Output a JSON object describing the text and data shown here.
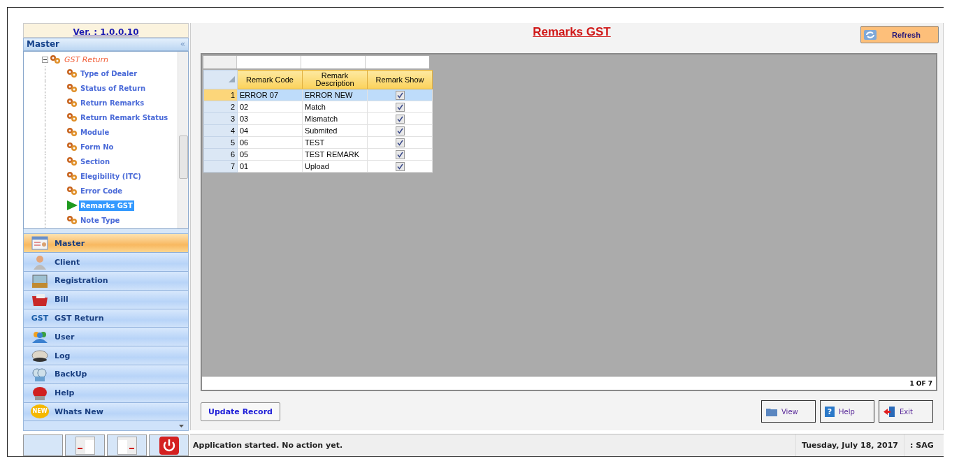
{
  "sidebar": {
    "version": "Ver. : 1.0.0.10",
    "panel_title": "Master",
    "collapse_glyph": "«",
    "tree": {
      "label": "GST Return",
      "expanded": true,
      "children": [
        {
          "label": "Type of Dealer",
          "selected": false
        },
        {
          "label": "Status of Return",
          "selected": false
        },
        {
          "label": "Return Remarks",
          "selected": false
        },
        {
          "label": "Return Remark Status",
          "selected": false
        },
        {
          "label": "Module",
          "selected": false
        },
        {
          "label": "Form No",
          "selected": false
        },
        {
          "label": "Section",
          "selected": false
        },
        {
          "label": "Elegibility (ITC)",
          "selected": false
        },
        {
          "label": "Error Code",
          "selected": false
        },
        {
          "label": "Remarks GST",
          "selected": true
        },
        {
          "label": "Note Type",
          "selected": false
        }
      ]
    }
  },
  "nav": [
    {
      "label": "Master",
      "selected": true
    },
    {
      "label": "Client",
      "selected": false
    },
    {
      "label": "Registration",
      "selected": false
    },
    {
      "label": "Bill",
      "selected": false
    },
    {
      "label": "GST Return",
      "selected": false,
      "icon_text": "GST"
    },
    {
      "label": "User",
      "selected": false
    },
    {
      "label": "Log",
      "selected": false
    },
    {
      "label": "BackUp",
      "selected": false
    },
    {
      "label": "Help",
      "selected": false
    },
    {
      "label": "Whats New",
      "selected": false,
      "icon_text": "NEW"
    }
  ],
  "page_title": "Remarks GST",
  "refresh_button": "Refresh",
  "grid": {
    "columns": [
      "Remark Code",
      "Remark Description",
      "Remark Show"
    ],
    "rows": [
      {
        "number": "1",
        "code": "ERROR 07",
        "description": "ERROR NEW",
        "show": true,
        "selected": true
      },
      {
        "number": "2",
        "code": "02",
        "description": "Match",
        "show": true,
        "selected": false
      },
      {
        "number": "3",
        "code": "03",
        "description": "Mismatch",
        "show": true,
        "selected": false
      },
      {
        "number": "4",
        "code": "04",
        "description": "Submited",
        "show": true,
        "selected": false
      },
      {
        "number": "5",
        "code": "06",
        "description": "TEST",
        "show": true,
        "selected": false
      },
      {
        "number": "6",
        "code": "05",
        "description": "TEST REMARK",
        "show": true,
        "selected": false
      },
      {
        "number": "7",
        "code": "01",
        "description": "Upload",
        "show": true,
        "selected": false
      }
    ],
    "record_count": "1 OF 7"
  },
  "buttons": {
    "update": "Update Record",
    "view": "View",
    "help": "Help",
    "help_glyph": "?",
    "exit": "Exit"
  },
  "status_bar": {
    "message": "Application started. No action yet.",
    "date": "Tuesday, July 18, 2017",
    "user": ": SAG"
  }
}
